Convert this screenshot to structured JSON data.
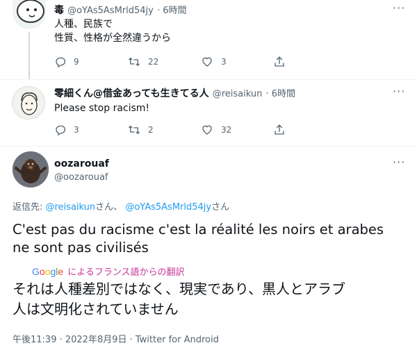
{
  "tweet1": {
    "name": "毒",
    "handle": "@oYAs5AsMrld54jy",
    "time": "6時間",
    "more": "···",
    "lines": [
      "人種、民族で",
      "性質、性格が全然違うから"
    ],
    "replies": "9",
    "retweets": "22",
    "likes": "3"
  },
  "tweet2": {
    "name": "零細くん@借金あっても生きてる人",
    "handle": "@reisaikun",
    "time": "6時間",
    "more": "···",
    "text": "Please stop racism!",
    "replies": "3",
    "retweets": "2",
    "likes": "32"
  },
  "main": {
    "name": "oozarouaf",
    "handle": "@oozarouaf",
    "more": "···",
    "reply_to_label": "返信先:",
    "reply_to_user1": "@reisaikun",
    "reply_to_san1": "さん、",
    "reply_to_user2": "@oYAs5AsMrld54jy",
    "reply_to_san2": "さん",
    "text_line1": "C'est pas du racisme c'est la réalité les noirs et arabes",
    "text_line2": "ne sont pas civilisés",
    "translate_brand": "Google",
    "translate_label": "によるフランス語からの翻訳",
    "translation_line1": "それは人種差別ではなく、現実であり、黒人とアラブ",
    "translation_line2": "人は文明化されていません",
    "timestamp": "午後11:39 · 2022年8月9日 · Twitter for Android"
  },
  "colors": {
    "text": "#0f1419",
    "secondary": "#536471",
    "link": "#1d9bf0",
    "translate": "#c8369b"
  },
  "icons": [
    "reply-icon",
    "retweet-icon",
    "like-icon",
    "share-icon",
    "more-icon"
  ]
}
